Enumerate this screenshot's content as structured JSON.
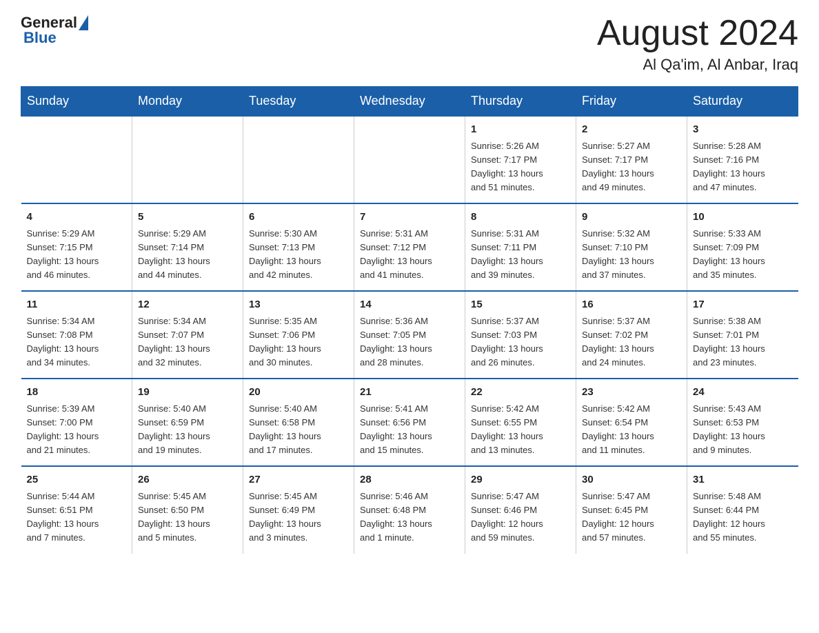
{
  "header": {
    "logo_general": "General",
    "logo_blue": "Blue",
    "title": "August 2024",
    "subtitle": "Al Qa'im, Al Anbar, Iraq"
  },
  "days_of_week": [
    "Sunday",
    "Monday",
    "Tuesday",
    "Wednesday",
    "Thursday",
    "Friday",
    "Saturday"
  ],
  "weeks": [
    [
      {
        "day": "",
        "info": ""
      },
      {
        "day": "",
        "info": ""
      },
      {
        "day": "",
        "info": ""
      },
      {
        "day": "",
        "info": ""
      },
      {
        "day": "1",
        "info": "Sunrise: 5:26 AM\nSunset: 7:17 PM\nDaylight: 13 hours\nand 51 minutes."
      },
      {
        "day": "2",
        "info": "Sunrise: 5:27 AM\nSunset: 7:17 PM\nDaylight: 13 hours\nand 49 minutes."
      },
      {
        "day": "3",
        "info": "Sunrise: 5:28 AM\nSunset: 7:16 PM\nDaylight: 13 hours\nand 47 minutes."
      }
    ],
    [
      {
        "day": "4",
        "info": "Sunrise: 5:29 AM\nSunset: 7:15 PM\nDaylight: 13 hours\nand 46 minutes."
      },
      {
        "day": "5",
        "info": "Sunrise: 5:29 AM\nSunset: 7:14 PM\nDaylight: 13 hours\nand 44 minutes."
      },
      {
        "day": "6",
        "info": "Sunrise: 5:30 AM\nSunset: 7:13 PM\nDaylight: 13 hours\nand 42 minutes."
      },
      {
        "day": "7",
        "info": "Sunrise: 5:31 AM\nSunset: 7:12 PM\nDaylight: 13 hours\nand 41 minutes."
      },
      {
        "day": "8",
        "info": "Sunrise: 5:31 AM\nSunset: 7:11 PM\nDaylight: 13 hours\nand 39 minutes."
      },
      {
        "day": "9",
        "info": "Sunrise: 5:32 AM\nSunset: 7:10 PM\nDaylight: 13 hours\nand 37 minutes."
      },
      {
        "day": "10",
        "info": "Sunrise: 5:33 AM\nSunset: 7:09 PM\nDaylight: 13 hours\nand 35 minutes."
      }
    ],
    [
      {
        "day": "11",
        "info": "Sunrise: 5:34 AM\nSunset: 7:08 PM\nDaylight: 13 hours\nand 34 minutes."
      },
      {
        "day": "12",
        "info": "Sunrise: 5:34 AM\nSunset: 7:07 PM\nDaylight: 13 hours\nand 32 minutes."
      },
      {
        "day": "13",
        "info": "Sunrise: 5:35 AM\nSunset: 7:06 PM\nDaylight: 13 hours\nand 30 minutes."
      },
      {
        "day": "14",
        "info": "Sunrise: 5:36 AM\nSunset: 7:05 PM\nDaylight: 13 hours\nand 28 minutes."
      },
      {
        "day": "15",
        "info": "Sunrise: 5:37 AM\nSunset: 7:03 PM\nDaylight: 13 hours\nand 26 minutes."
      },
      {
        "day": "16",
        "info": "Sunrise: 5:37 AM\nSunset: 7:02 PM\nDaylight: 13 hours\nand 24 minutes."
      },
      {
        "day": "17",
        "info": "Sunrise: 5:38 AM\nSunset: 7:01 PM\nDaylight: 13 hours\nand 23 minutes."
      }
    ],
    [
      {
        "day": "18",
        "info": "Sunrise: 5:39 AM\nSunset: 7:00 PM\nDaylight: 13 hours\nand 21 minutes."
      },
      {
        "day": "19",
        "info": "Sunrise: 5:40 AM\nSunset: 6:59 PM\nDaylight: 13 hours\nand 19 minutes."
      },
      {
        "day": "20",
        "info": "Sunrise: 5:40 AM\nSunset: 6:58 PM\nDaylight: 13 hours\nand 17 minutes."
      },
      {
        "day": "21",
        "info": "Sunrise: 5:41 AM\nSunset: 6:56 PM\nDaylight: 13 hours\nand 15 minutes."
      },
      {
        "day": "22",
        "info": "Sunrise: 5:42 AM\nSunset: 6:55 PM\nDaylight: 13 hours\nand 13 minutes."
      },
      {
        "day": "23",
        "info": "Sunrise: 5:42 AM\nSunset: 6:54 PM\nDaylight: 13 hours\nand 11 minutes."
      },
      {
        "day": "24",
        "info": "Sunrise: 5:43 AM\nSunset: 6:53 PM\nDaylight: 13 hours\nand 9 minutes."
      }
    ],
    [
      {
        "day": "25",
        "info": "Sunrise: 5:44 AM\nSunset: 6:51 PM\nDaylight: 13 hours\nand 7 minutes."
      },
      {
        "day": "26",
        "info": "Sunrise: 5:45 AM\nSunset: 6:50 PM\nDaylight: 13 hours\nand 5 minutes."
      },
      {
        "day": "27",
        "info": "Sunrise: 5:45 AM\nSunset: 6:49 PM\nDaylight: 13 hours\nand 3 minutes."
      },
      {
        "day": "28",
        "info": "Sunrise: 5:46 AM\nSunset: 6:48 PM\nDaylight: 13 hours\nand 1 minute."
      },
      {
        "day": "29",
        "info": "Sunrise: 5:47 AM\nSunset: 6:46 PM\nDaylight: 12 hours\nand 59 minutes."
      },
      {
        "day": "30",
        "info": "Sunrise: 5:47 AM\nSunset: 6:45 PM\nDaylight: 12 hours\nand 57 minutes."
      },
      {
        "day": "31",
        "info": "Sunrise: 5:48 AM\nSunset: 6:44 PM\nDaylight: 12 hours\nand 55 minutes."
      }
    ]
  ]
}
